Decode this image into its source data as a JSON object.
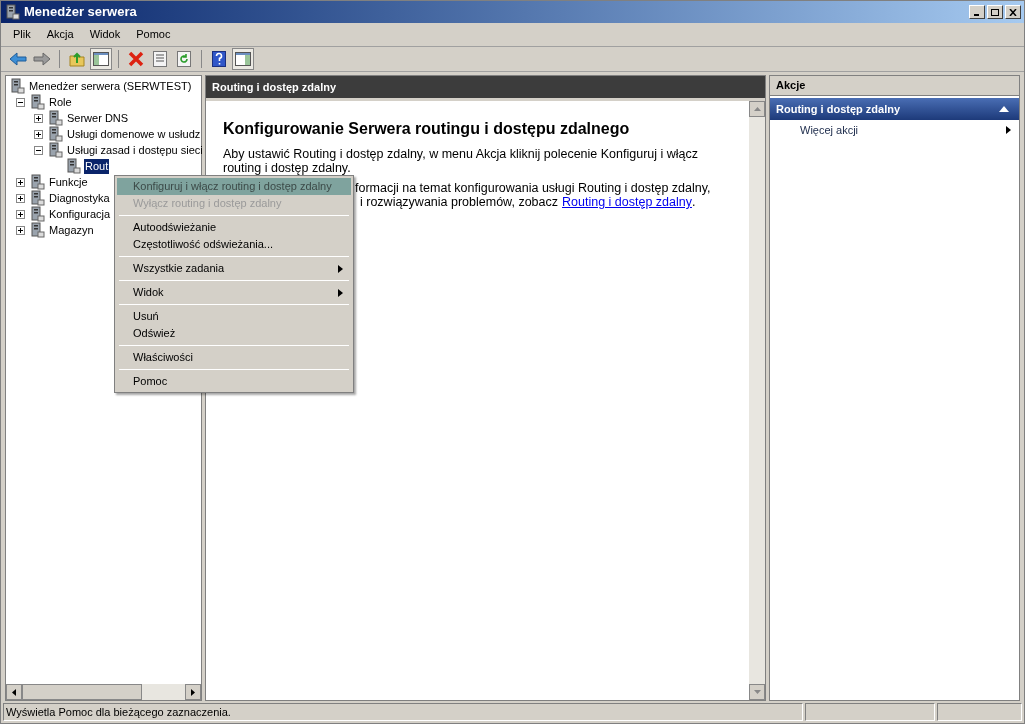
{
  "window": {
    "title": "Menedżer serwera"
  },
  "menu_bar": [
    "Plik",
    "Akcja",
    "Widok",
    "Pomoc"
  ],
  "toolbar": [
    {
      "kind": "back",
      "pressed": false
    },
    {
      "kind": "forward",
      "pressed": false
    },
    {
      "kind": "sep"
    },
    {
      "kind": "up",
      "pressed": false
    },
    {
      "kind": "tree",
      "pressed": true
    },
    {
      "kind": "sep"
    },
    {
      "kind": "delete",
      "pressed": false
    },
    {
      "kind": "properties",
      "pressed": false
    },
    {
      "kind": "refresh",
      "pressed": false
    },
    {
      "kind": "sep"
    },
    {
      "kind": "help",
      "pressed": false
    },
    {
      "kind": "actions",
      "pressed": true
    }
  ],
  "tree": [
    {
      "label": "Menedżer serwera (SERWTEST)",
      "children": [
        {
          "label": "Role",
          "expanded": true,
          "children": [
            {
              "label": "Serwer DNS",
              "expanded": false
            },
            {
              "label": "Usługi domenowe w usłudz",
              "expanded": false
            },
            {
              "label": "Usługi zasad i dostępu sieci",
              "expanded": true,
              "children": [
                {
                  "label": "Rout",
                  "selected": true
                }
              ]
            }
          ]
        },
        {
          "label": "Funkcje",
          "expanded": false
        },
        {
          "label": "Diagnostyka",
          "expanded": false
        },
        {
          "label": "Konfiguracja",
          "expanded": false
        },
        {
          "label": "Magazyn",
          "expanded": false
        }
      ]
    }
  ],
  "content": {
    "header": "Routing i dostęp zdalny",
    "heading": "Konfigurowanie Serwera routingu i dostępu zdalnego",
    "paragraph_1": [
      "Aby ustawić Routing i dostęp zdalny, w menu Akcja kliknij polecenie Konfiguruj i włącz",
      "routing i dostęp zdalny."
    ],
    "paragraph_2_visible": [
      "formacji na temat konfigurowania usługi Routing i dostęp zdalny,",
      "i rozwiązywania problemów, zobacz"
    ],
    "link": "Routing i dostęp zdalny",
    "link_end": "."
  },
  "context_menu": [
    [
      {
        "label": "Konfiguruj i włącz routing i dostęp zdalny",
        "selected": true,
        "disabled": false,
        "submenu": false
      },
      {
        "label": "Wyłącz routing i dostęp zdalny",
        "selected": false,
        "disabled": true,
        "submenu": false
      }
    ],
    [
      {
        "label": "Autoodświeżanie",
        "selected": false,
        "disabled": false,
        "submenu": false
      },
      {
        "label": "Częstotliwość odświeżania...",
        "selected": false,
        "disabled": false,
        "submenu": false
      }
    ],
    [
      {
        "label": "Wszystkie zadania",
        "selected": false,
        "disabled": false,
        "submenu": true
      }
    ],
    [
      {
        "label": "Widok",
        "selected": false,
        "disabled": false,
        "submenu": true
      }
    ],
    [
      {
        "label": "Usuń",
        "selected": false,
        "disabled": false,
        "submenu": false
      },
      {
        "label": "Odśwież",
        "selected": false,
        "disabled": false,
        "submenu": false
      }
    ],
    [
      {
        "label": "Właściwości",
        "selected": false,
        "disabled": false,
        "submenu": false
      }
    ],
    [
      {
        "label": "Pomoc",
        "selected": false,
        "disabled": false,
        "submenu": false
      }
    ]
  ],
  "actions": {
    "header": "Akcje",
    "section": {
      "title": "Routing i dostęp zdalny",
      "expanded": true
    },
    "items": [
      {
        "label": "Więcej akcji",
        "submenu": true
      }
    ]
  },
  "status_bar": {
    "text": "Wyświetla Pomoc dla bieżącego zaznaczenia."
  }
}
